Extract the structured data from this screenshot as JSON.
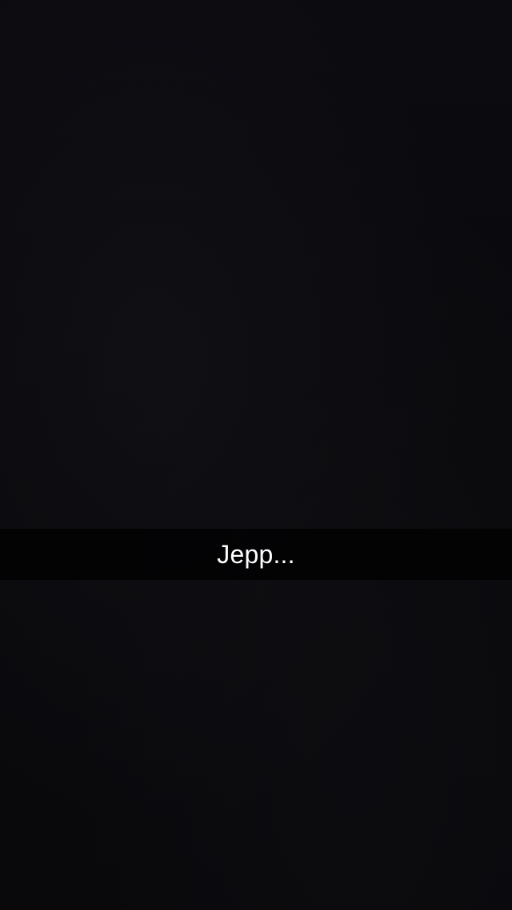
{
  "caption": {
    "text": "Jepp..."
  },
  "colors": {
    "background": "#0a0a0d",
    "caption_bar": "#000000",
    "caption_text": "#ffffff"
  }
}
